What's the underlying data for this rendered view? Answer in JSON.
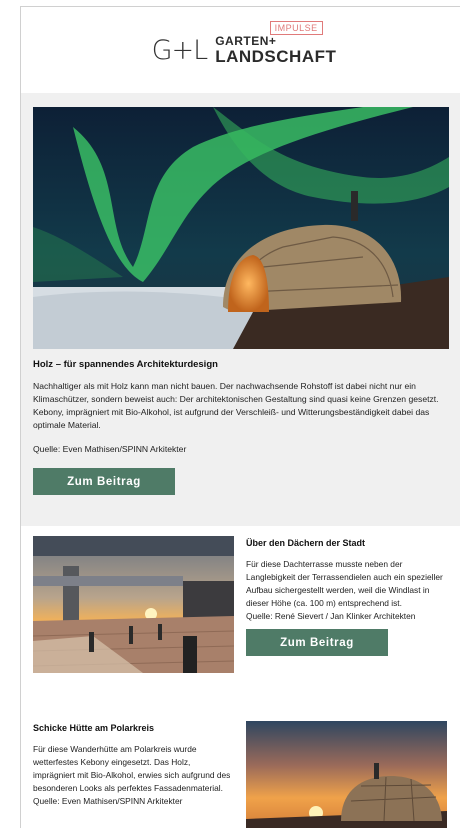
{
  "header": {
    "logo_gl": "G+L",
    "logo_word1": "GARTEN+",
    "logo_word2": "LANDSCHAFT",
    "logo_badge": "IMPULSE"
  },
  "featured": {
    "title": "Holz – für spannendes Architekturdesign",
    "text": "Nachhaltiger als mit Holz kann man nicht bauen. Der nachwachsende Rohstoff ist dabei nicht nur ein Klimaschützer, sondern beweist auch: Der architektonischen Gestaltung sind quasi keine Grenzen gesetzt. Kebony, imprägniert mit Bio-Alkohol, ist aufgrund der Verschleiß- und Witterungsbeständigkeit dabei das optimale Material.",
    "source": "Quelle: Even Mathisen/SPINN Arkitekter",
    "button_label": "Zum Beitrag"
  },
  "article2": {
    "title": "Über den Dächern der Stadt",
    "text": "Für diese Dachterrasse musste neben der Langlebigkeit der Terrassendielen auch ein spezieller Aufbau sichergestellt werden, weil die Windlast in dieser Höhe (ca. 100 m) entsprechend ist.",
    "source": "Quelle: René Sievert / Jan Klinker Architekten",
    "button_label": "Zum Beitrag"
  },
  "article3": {
    "title": "Schicke Hütte am Polarkreis",
    "text": "Für diese Wanderhütte am Polarkreis wurde wetterfestes Kebony eingesetzt. Das Holz, imprägniert mit Bio-Alkohol, erwies sich aufgrund des besonderen Looks als perfektes Fassadenmaterial.",
    "source": "Quelle: Even Mathisen/SPINN Arkitekter"
  },
  "colors": {
    "button": "#4f7b67",
    "badge": "#e07a7a",
    "hero_background": "#f0f0f0"
  }
}
